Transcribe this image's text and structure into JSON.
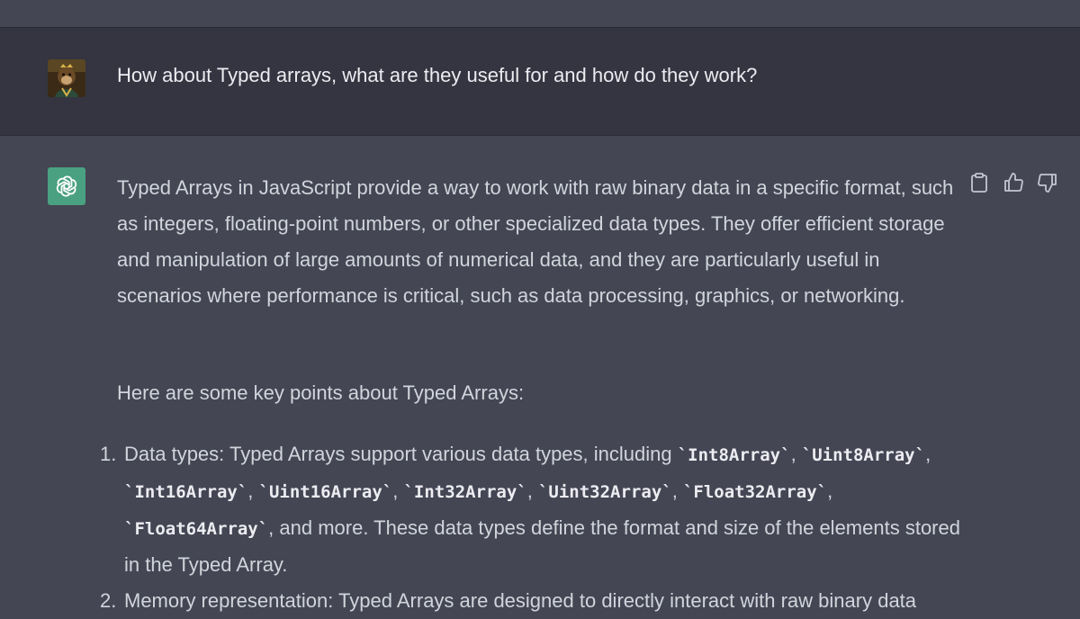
{
  "user": {
    "avatar_icon": "monkey-portrait-avatar",
    "message": "How about Typed arrays, what are they useful for and how do they work?"
  },
  "assistant": {
    "icon": "openai-logo-icon",
    "actions": [
      {
        "icon": "clipboard-icon"
      },
      {
        "icon": "thumbs-up-icon"
      },
      {
        "icon": "thumbs-down-icon"
      }
    ],
    "paragraph1": "Typed Arrays in JavaScript provide a way to work with raw binary data in a specific format, such as integers, floating-point numbers, or other specialized data types. They offer efficient storage and manipulation of large amounts of numerical data, and they are particularly useful in scenarios where performance is critical, such as data processing, graphics, or networking.",
    "paragraph2": "Here are some key points about Typed Arrays:",
    "list": {
      "item1": {
        "number": "1.",
        "prefix": "Data types: Typed Arrays support various data types, including ",
        "codes": [
          "`Int8Array`",
          "`Uint8Array`",
          "`Int16Array`",
          "`Uint16Array`",
          "`Int32Array`",
          "`Uint32Array`",
          "`Float32Array`",
          "`Float64Array`"
        ],
        "sep": ", ",
        "suffix": ", and more. These data types define the format and size of the elements stored in the Typed Array."
      },
      "item2": {
        "number": "2.",
        "text": "Memory representation: Typed Arrays are designed to directly interact with raw binary data"
      }
    }
  },
  "colors": {
    "user_bg": "#343541",
    "assistant_bg": "#444654",
    "gpt_green": "#4aa181"
  }
}
